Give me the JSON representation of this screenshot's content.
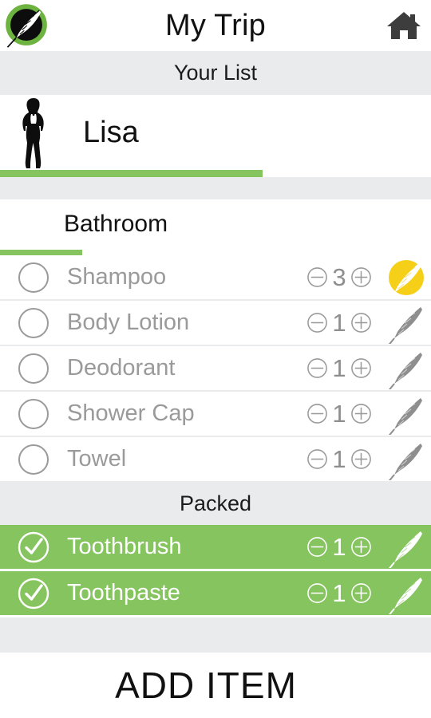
{
  "header": {
    "title": "My Trip",
    "logo_icon": "feather-circle-logo",
    "home_icon": "home-icon"
  },
  "list_band": {
    "label": "Your List"
  },
  "user": {
    "name": "Lisa",
    "avatar_icon": "woman-silhouette-avatar",
    "progress_percent": 61
  },
  "category": {
    "name": "Bathroom",
    "progress_percent": 19
  },
  "colors": {
    "green": "#85c45e",
    "yellow": "#f5cf18",
    "gray_band": "#e9ebec",
    "item_text": "#9a9a9a",
    "dark_text": "#111111"
  },
  "items": [
    {
      "name": "Shampoo",
      "qty": "3",
      "checked": false,
      "check_icon": "empty-circle-checkbox",
      "minus_icon": "circle-minus-icon",
      "plus_icon": "circle-plus-icon",
      "feather_icon": "feather-icon",
      "feather_state": "highlighted"
    },
    {
      "name": "Body Lotion",
      "qty": "1",
      "checked": false,
      "check_icon": "empty-circle-checkbox",
      "minus_icon": "circle-minus-icon",
      "plus_icon": "circle-plus-icon",
      "feather_icon": "feather-icon",
      "feather_state": "gray"
    },
    {
      "name": "Deodorant",
      "qty": "1",
      "checked": false,
      "check_icon": "empty-circle-checkbox",
      "minus_icon": "circle-minus-icon",
      "plus_icon": "circle-plus-icon",
      "feather_icon": "feather-icon",
      "feather_state": "gray"
    },
    {
      "name": "Shower Cap",
      "qty": "1",
      "checked": false,
      "check_icon": "empty-circle-checkbox",
      "minus_icon": "circle-minus-icon",
      "plus_icon": "circle-plus-icon",
      "feather_icon": "feather-icon",
      "feather_state": "gray"
    },
    {
      "name": "Towel",
      "qty": "1",
      "checked": false,
      "check_icon": "empty-circle-checkbox",
      "minus_icon": "circle-minus-icon",
      "plus_icon": "circle-plus-icon",
      "feather_icon": "feather-icon",
      "feather_state": "gray"
    }
  ],
  "packed_band": {
    "label": "Packed"
  },
  "packed_items": [
    {
      "name": "Toothbrush",
      "qty": "1",
      "checked": true,
      "check_icon": "circle-check-icon",
      "minus_icon": "circle-minus-icon",
      "plus_icon": "circle-plus-icon",
      "feather_icon": "feather-icon",
      "feather_state": "white"
    },
    {
      "name": "Toothpaste",
      "qty": "1",
      "checked": true,
      "check_icon": "circle-check-icon",
      "minus_icon": "circle-minus-icon",
      "plus_icon": "circle-plus-icon",
      "feather_icon": "feather-icon",
      "feather_state": "white"
    }
  ],
  "footer": {
    "add_item_label": "ADD ITEM"
  }
}
